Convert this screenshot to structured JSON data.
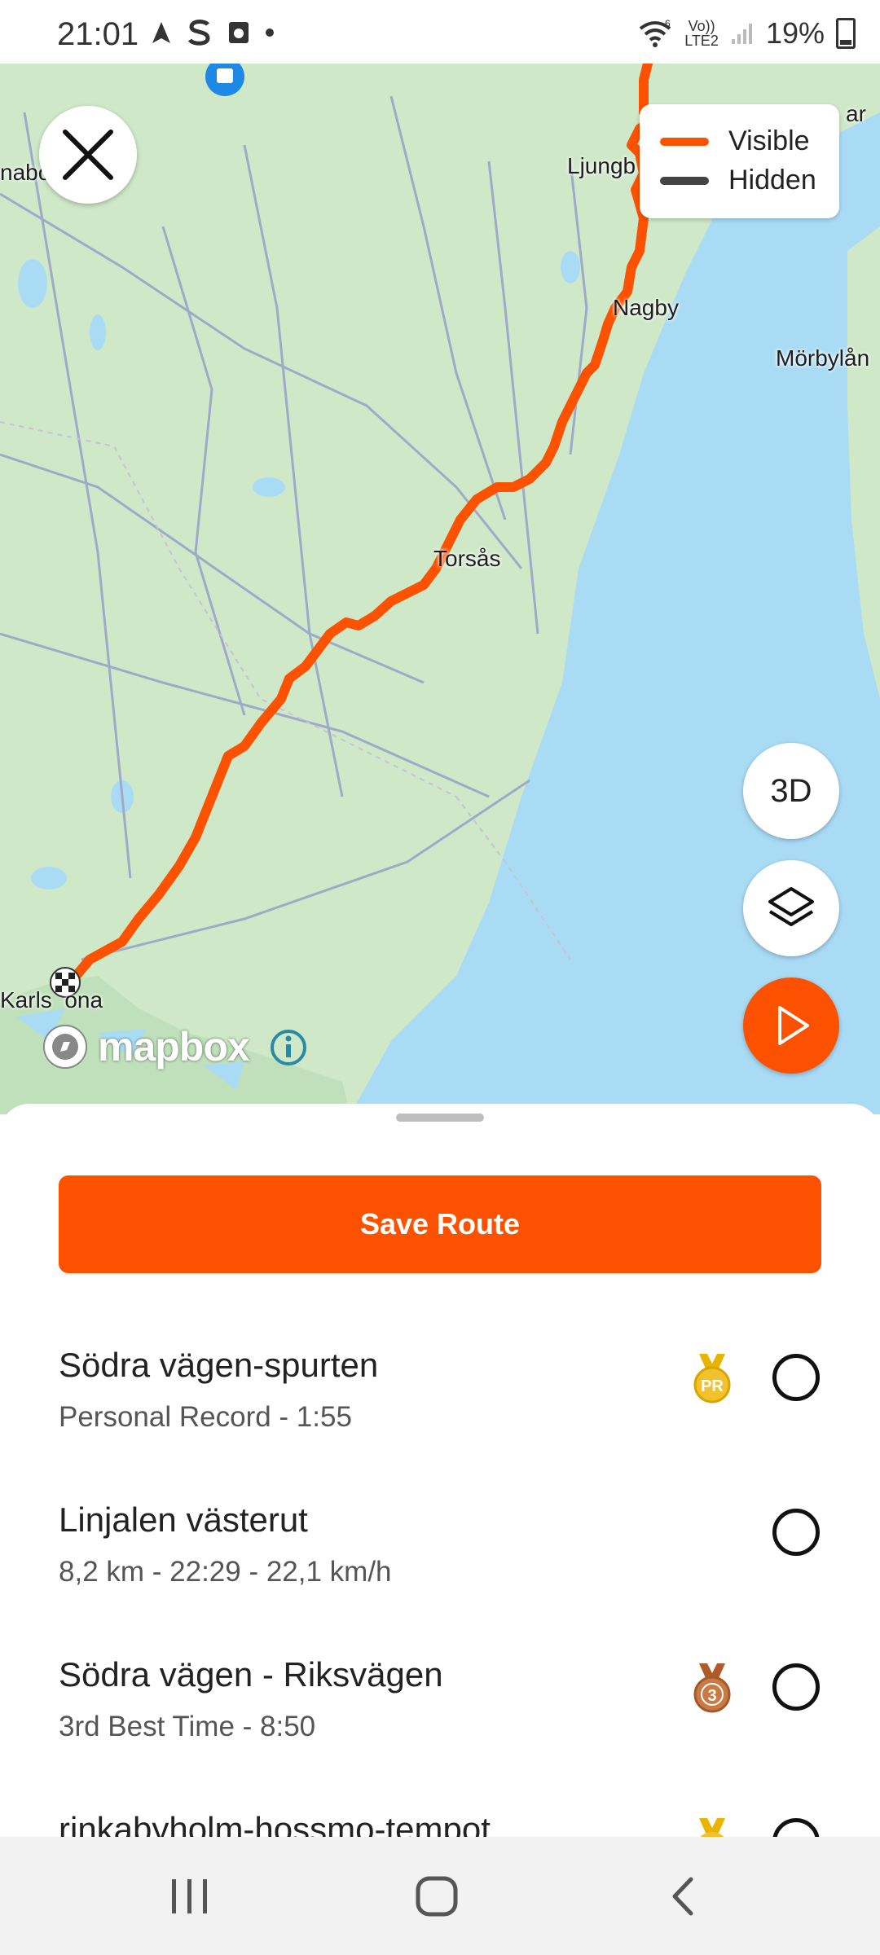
{
  "status_bar": {
    "time": "21:01",
    "network_label_top": "Vo))",
    "network_label_bottom": "LTE2",
    "wifi_badge": "6",
    "battery": "19%"
  },
  "map": {
    "cities": [
      {
        "id": "nabo",
        "label": "nabo"
      },
      {
        "id": "ljungby",
        "label": "Ljungb"
      },
      {
        "id": "nagby",
        "label": "Nagby"
      },
      {
        "id": "morbylanga",
        "label": "Mörbylån"
      },
      {
        "id": "torsas",
        "label": "Torsås"
      },
      {
        "id": "karlskrona",
        "label": "Karls  ona"
      },
      {
        "id": "kalmar",
        "label": "ar"
      }
    ],
    "legend": {
      "visible_label": "Visible",
      "hidden_label": "Hidden",
      "visible_color": "#fc5200",
      "hidden_color": "#444444"
    },
    "buttons": {
      "three_d_label": "3D"
    },
    "attribution": "mapbox"
  },
  "sheet": {
    "save_button_label": "Save Route",
    "segments": [
      {
        "name": "Södra vägen-spurten",
        "meta": "Personal Record - 1:55",
        "medal": "pr",
        "medal_label": "PR"
      },
      {
        "name": "Linjalen västerut",
        "meta": "8,2 km - 22:29 - 22,1 km/h",
        "medal": "none",
        "medal_label": ""
      },
      {
        "name": "Södra vägen - Riksvägen",
        "meta": "3rd Best Time - 8:50",
        "medal": "bronze",
        "medal_label": "3"
      },
      {
        "name": "rinkabyholm-hossmo-tempot",
        "meta": "",
        "medal": "gold",
        "medal_label": ""
      }
    ]
  },
  "colors": {
    "brand_orange": "#fc5200",
    "water": "#aadbf5",
    "land": "#cfe8c8"
  }
}
